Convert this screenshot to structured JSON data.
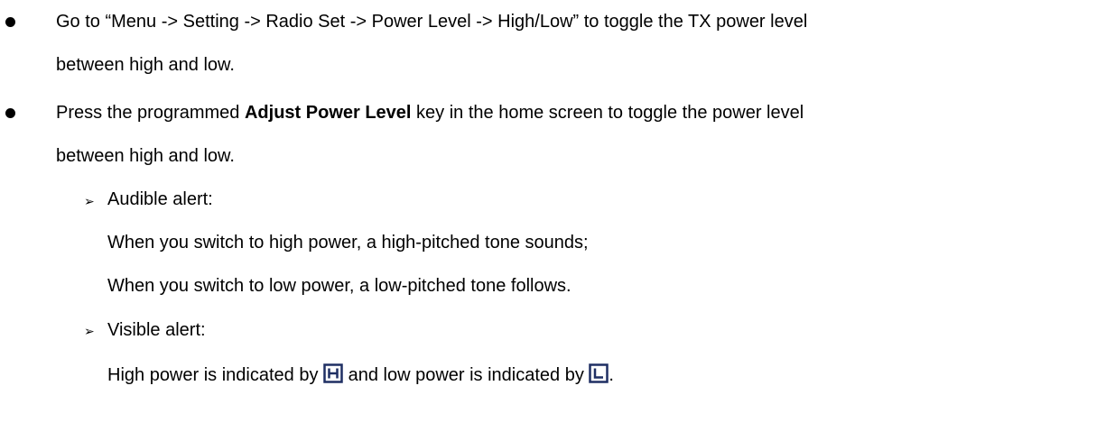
{
  "bullets": [
    {
      "line1": "Go to “Menu -> Setting -> Radio Set -> Power Level -> High/Low” to toggle the TX power level",
      "line2": "between high and low."
    },
    {
      "prefix": "Press the programmed ",
      "bold": "Adjust Power Level",
      "suffix": " key in the home screen to toggle the power level",
      "line2": "between high and low."
    }
  ],
  "sub_arrow": "➢",
  "audible": {
    "label": "Audible alert:",
    "line1": "When you switch to high power, a high-pitched tone sounds;",
    "line2": "When you switch to low power, a low-pitched tone follows."
  },
  "visible": {
    "label": "Visible alert:",
    "text_before": "High power is indicated by",
    "text_middle": "and low power is indicated by",
    "text_end": ".",
    "high_icon_letter": "H",
    "low_icon_letter": "L",
    "icon_color": "#1f2f63"
  }
}
